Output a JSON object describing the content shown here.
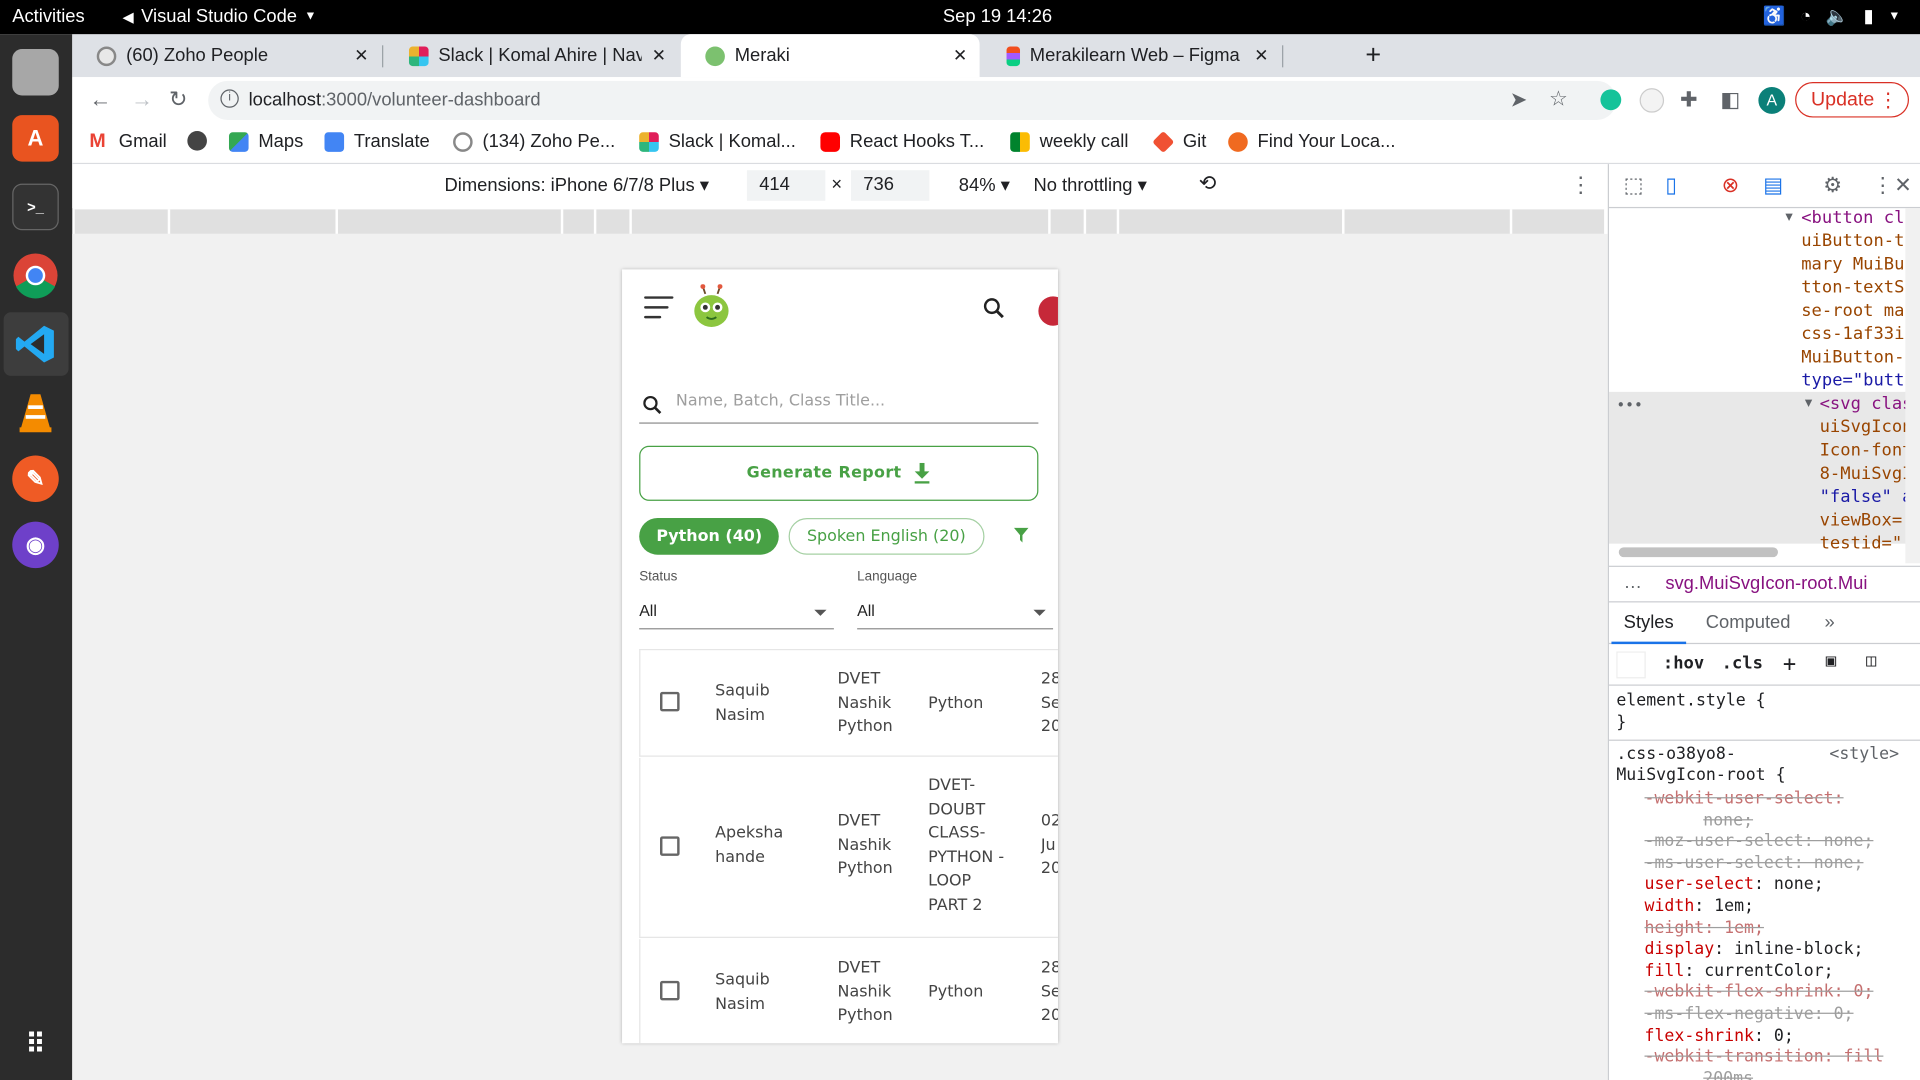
{
  "os": {
    "activities": "Activities",
    "app_name": "Visual Studio Code",
    "clock": "Sep 19  14:26"
  },
  "browser": {
    "tabs": [
      {
        "label": "(60) Zoho People",
        "active": false
      },
      {
        "label": "Slack | Komal Ahire | Navgurukul",
        "active": false
      },
      {
        "label": "Meraki",
        "active": true
      },
      {
        "label": "Merakilearn Web – Figma",
        "active": false
      }
    ],
    "url_host": "localhost",
    "url_path": ":3000/volunteer-dashboard",
    "update_label": "Update",
    "profile_initial": "A",
    "bookmarks": [
      "Gmail",
      "Maps",
      "Translate",
      "(134) Zoho Pe...",
      "Slack | Komal...",
      "React Hooks T...",
      "weekly call",
      "Git",
      "Find Your Loca..."
    ]
  },
  "device_toolbar": {
    "dimensions_label": "Dimensions: iPhone 6/7/8 Plus",
    "width": "414",
    "height": "736",
    "zoom": "84%",
    "throttling": "No throttling"
  },
  "app": {
    "search_placeholder": "Name, Batch, Class Title...",
    "generate_report_label": "Generate Report",
    "chips": {
      "python": "Python (40)",
      "spoken_english": "Spoken English (20)"
    },
    "filters": [
      {
        "label": "Status",
        "value": "All"
      },
      {
        "label": "Language",
        "value": "All"
      }
    ],
    "rows": [
      {
        "name": [
          "Saquib",
          "Nasim"
        ],
        "batch": [
          "DVET",
          "Nashik",
          "Python"
        ],
        "class_title": [
          "Python"
        ],
        "date": [
          "28",
          "Se",
          "20"
        ]
      },
      {
        "name": [
          "Apeksha",
          "hande"
        ],
        "batch": [
          "DVET",
          "Nashik",
          "Python"
        ],
        "class_title": [
          "DVET-",
          "DOUBT",
          "CLASS-",
          "PYTHON -",
          "LOOP",
          "PART 2"
        ],
        "date": [
          "02",
          "Ju",
          "20"
        ]
      },
      {
        "name": [
          "Saquib",
          "Nasim"
        ],
        "batch": [
          "DVET",
          "Nashik",
          "Python"
        ],
        "class_title": [
          "Python"
        ],
        "date": [
          "28",
          "Se",
          "20"
        ]
      }
    ]
  },
  "devtools": {
    "elements_lines": [
      "<button cl",
      "uiButton-t",
      "mary MuiBu",
      "tton-textS",
      "se-root ma",
      "css-1af33i",
      "MuiButton-",
      "type=\"butt",
      "<svg clas",
      "uiSvgIcon",
      "Icon-font",
      "8-MuiSvgI",
      "\"false\" a",
      "viewBox=",
      "testid=\""
    ],
    "breadcrumb": "svg.MuiSvgIcon-root.Mui",
    "tabs": [
      "Styles",
      "Computed"
    ],
    "filter_hov": ":hov",
    "filter_cls": ".cls",
    "element_style": "element.style {",
    "close_brace": "}",
    "rule_selector": ".css-o38yo8-MuiSvgIcon-root {",
    "rule_source": "<style>",
    "declarations": [
      {
        "text": "-webkit-user-select:",
        "strike": true
      },
      {
        "text": "none;",
        "strike": true,
        "indent": true
      },
      {
        "text": "-moz-user-select: none;",
        "strike": true
      },
      {
        "text": "-ms-user-select: none;",
        "strike": true
      },
      {
        "text": "user-select: none;",
        "strike": false
      },
      {
        "text": "width: 1em;",
        "strike": false
      },
      {
        "text": "height: 1em;",
        "strike": true
      },
      {
        "text": "display: inline-block;",
        "strike": false
      },
      {
        "text": "fill: currentColor;",
        "strike": false
      },
      {
        "text": "-webkit-flex-shrink: 0;",
        "strike": true
      },
      {
        "text": "-ms-flex-negative: 0;",
        "strike": true
      },
      {
        "text": "flex-shrink: 0;",
        "strike": false
      },
      {
        "text": "-webkit-transition: fill",
        "strike": true
      },
      {
        "text": "200ms",
        "strike": true,
        "indent": true
      }
    ]
  },
  "colors": {
    "brand_green": "#48a145",
    "update_red": "#d93025",
    "devtools_tag": "#881280"
  }
}
